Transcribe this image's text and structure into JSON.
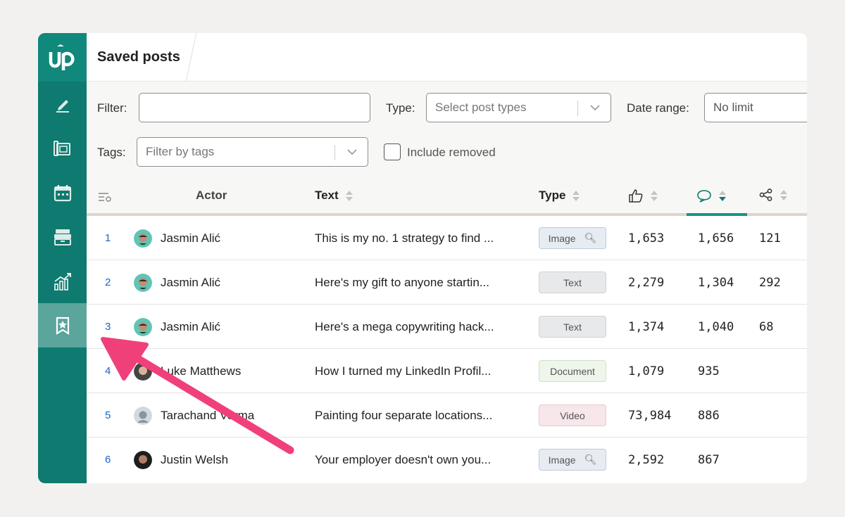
{
  "app": {
    "logo_text": "up",
    "title": "Saved posts"
  },
  "sidebar": {
    "items": [
      {
        "name": "editor",
        "icon": "pen-icon",
        "active": false
      },
      {
        "name": "board",
        "icon": "board-icon",
        "active": false
      },
      {
        "name": "calendar",
        "icon": "calendar-icon",
        "active": false
      },
      {
        "name": "archive",
        "icon": "archive-icon",
        "active": false
      },
      {
        "name": "analytics",
        "icon": "chart-icon",
        "active": false
      },
      {
        "name": "saved",
        "icon": "bookmark-star-icon",
        "active": true
      }
    ]
  },
  "filters": {
    "filter_label": "Filter:",
    "filter_value": "",
    "type_label": "Type:",
    "type_placeholder": "Select post types",
    "date_label": "Date range:",
    "date_value": "No limit",
    "tags_label": "Tags:",
    "tags_placeholder": "Filter by tags",
    "include_removed_label": "Include removed"
  },
  "table": {
    "columns": {
      "actor": "Actor",
      "text": "Text",
      "type": "Type"
    },
    "rows": [
      {
        "index": "1",
        "actor": "Jasmin Alić",
        "text": "This is my no. 1 strategy to find ...",
        "type": "Image",
        "likes": "1,653",
        "comments": "1,656",
        "shares": "121"
      },
      {
        "index": "2",
        "actor": "Jasmin Alić",
        "text": "Here's my gift to anyone startin...",
        "type": "Text",
        "likes": "2,279",
        "comments": "1,304",
        "shares": "292"
      },
      {
        "index": "3",
        "actor": "Jasmin Alić",
        "text": "Here's a mega copywriting hack...",
        "type": "Text",
        "likes": "1,374",
        "comments": "1,040",
        "shares": "68"
      },
      {
        "index": "4",
        "actor": "Luke Matthews",
        "text": "How I turned my LinkedIn Profil...",
        "type": "Document",
        "likes": "1,079",
        "comments": "935",
        "shares": ""
      },
      {
        "index": "5",
        "actor": "Tarachand Verma",
        "text": "Painting four separate locations...",
        "type": "Video",
        "likes": "73,984",
        "comments": "886",
        "shares": ""
      },
      {
        "index": "6",
        "actor": "Justin Welsh",
        "text": "Your employer doesn't own you...",
        "type": "Image",
        "likes": "2,592",
        "comments": "867",
        "shares": ""
      }
    ]
  },
  "colors": {
    "sidebar": "#0f7a6f",
    "accent": "#14958a",
    "link": "#1a66c2",
    "annotation_arrow": "#f0407a"
  }
}
